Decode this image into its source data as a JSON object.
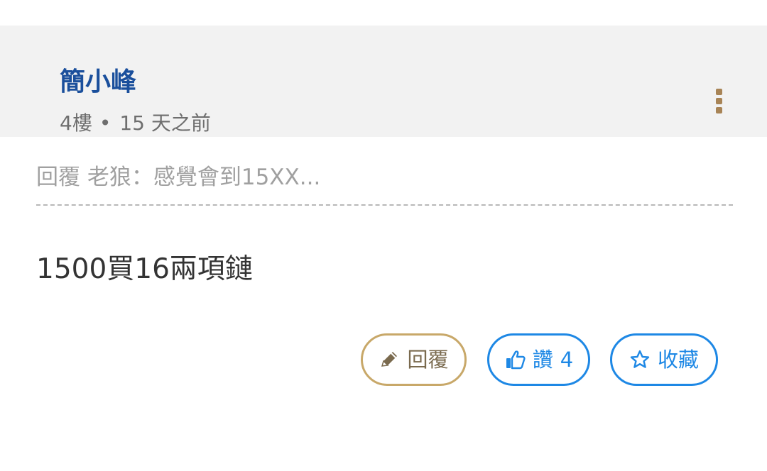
{
  "post": {
    "author": "簡小峰",
    "floor": "4樓",
    "separator": "•",
    "time_ago": "15 天之前",
    "quote": "回覆 老狼：感覺會到15XX...",
    "body": "1500買16兩項鏈"
  },
  "actions": {
    "reply_label": "回覆",
    "like_label": "讚",
    "like_count": "4",
    "favorite_label": "收藏"
  },
  "icons": {
    "more": "more-vertical-icon",
    "reply": "pencil-icon",
    "like": "thumbs-up-icon",
    "favorite": "star-icon"
  },
  "colors": {
    "author": "#1a4f9c",
    "meta": "#6e6e6e",
    "header_bg": "#f2f2f2",
    "accent_blue": "#1e88e5",
    "reply_border": "#c8a869",
    "reply_text": "#7a6a4e",
    "menu_dots": "#a88456"
  }
}
